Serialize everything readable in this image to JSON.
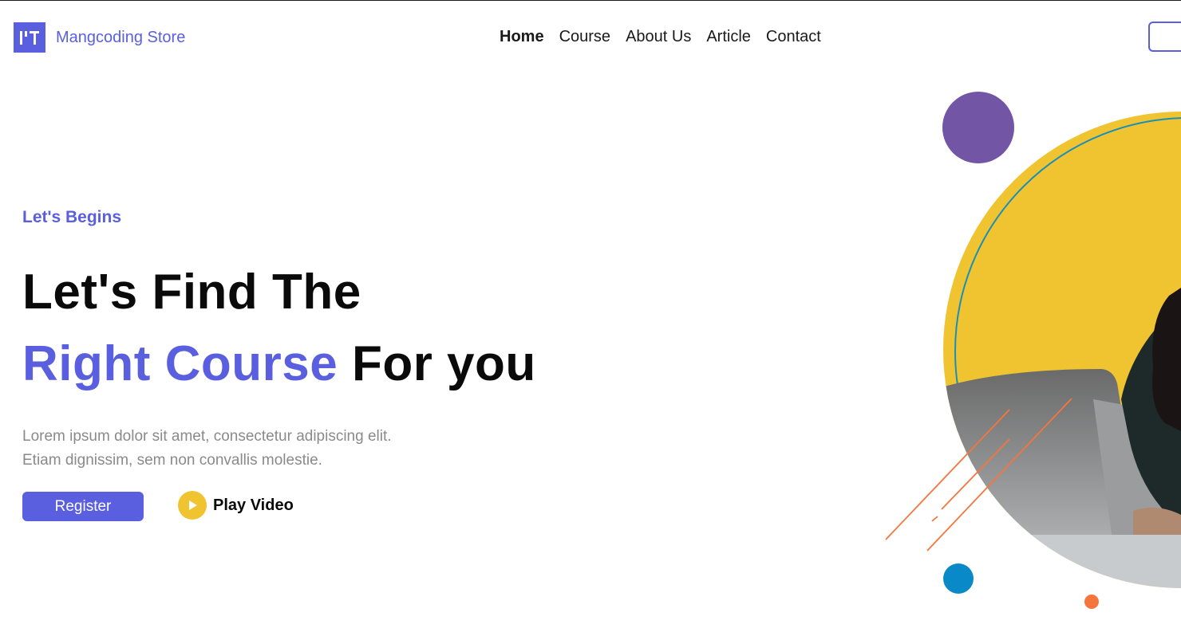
{
  "header": {
    "brand": "Mangcoding Store",
    "logo_icon": "mangcoding-logo-icon",
    "nav": [
      {
        "label": "Home",
        "active": true
      },
      {
        "label": "Course",
        "active": false
      },
      {
        "label": "About Us",
        "active": false
      },
      {
        "label": "Article",
        "active": false
      },
      {
        "label": "Contact",
        "active": false
      }
    ]
  },
  "hero": {
    "eyebrow": "Let's Begins",
    "title_line1": "Let's Find The",
    "title_accent": "Right Course",
    "title_rest": " For you",
    "description_line1": "Lorem ipsum dolor sit amet, consectetur adipiscing elit.",
    "description_line2": "Etiam dignissim, sem non convallis molestie.",
    "register_label": "Register",
    "play_label": "Play Video",
    "play_icon": "play-icon"
  },
  "colors": {
    "accent": "#5a5fe0",
    "yellow": "#f0c430",
    "purple": "#7355a5",
    "blue": "#0a89c8",
    "orange": "#f5763c"
  }
}
